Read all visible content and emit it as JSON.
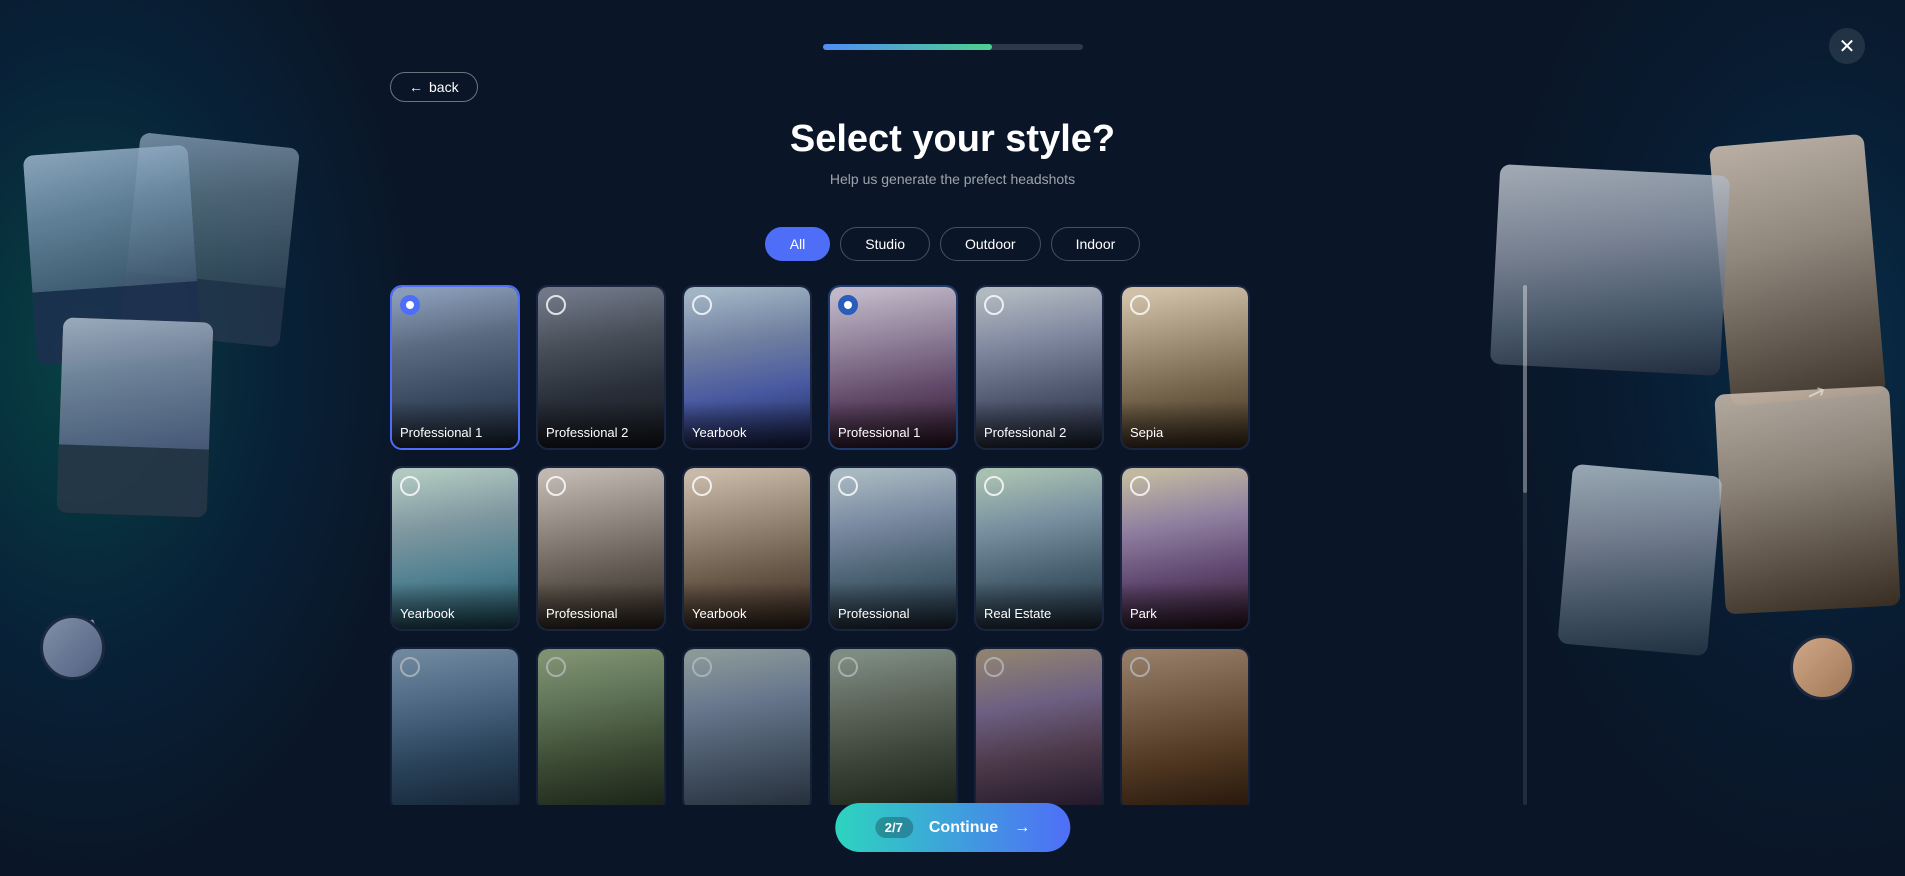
{
  "progress": {
    "fill_percent": "65%",
    "current_step": "2",
    "total_steps": "7",
    "step_label": "2/7"
  },
  "close_button": "✕",
  "back_button": {
    "label": "back",
    "arrow": "←"
  },
  "title": "Select your style?",
  "subtitle": "Help us generate the prefect headshots",
  "filters": [
    {
      "id": "all",
      "label": "All",
      "active": true
    },
    {
      "id": "studio",
      "label": "Studio",
      "active": false
    },
    {
      "id": "outdoor",
      "label": "Outdoor",
      "active": false
    },
    {
      "id": "indoor",
      "label": "Indoor",
      "active": false
    }
  ],
  "cards": [
    {
      "id": "pro1-male",
      "label": "Professional 1",
      "selected": "blue",
      "row": 1
    },
    {
      "id": "pro2-male",
      "label": "Professional 2",
      "selected": "none",
      "row": 1
    },
    {
      "id": "yearbook-male",
      "label": "Yearbook",
      "selected": "none",
      "row": 1
    },
    {
      "id": "pro1-female",
      "label": "Professional 1",
      "selected": "dark",
      "row": 1
    },
    {
      "id": "pro2-female",
      "label": "Professional 2",
      "selected": "none",
      "row": 1
    },
    {
      "id": "sepia",
      "label": "Sepia",
      "selected": "none",
      "row": 1
    },
    {
      "id": "yearbook-female",
      "label": "Yearbook",
      "selected": "none",
      "row": 2
    },
    {
      "id": "pro-female2",
      "label": "Professional",
      "selected": "none",
      "row": 2
    },
    {
      "id": "yearbook-female2",
      "label": "Yearbook",
      "selected": "none",
      "row": 2
    },
    {
      "id": "pro-male2",
      "label": "Professional",
      "selected": "none",
      "row": 2
    },
    {
      "id": "real-estate",
      "label": "Real Estate",
      "selected": "none",
      "row": 2
    },
    {
      "id": "park",
      "label": "Park",
      "selected": "none",
      "row": 2
    },
    {
      "id": "card13",
      "label": "",
      "selected": "none",
      "row": 3
    },
    {
      "id": "card14",
      "label": "",
      "selected": "none",
      "row": 3
    },
    {
      "id": "card15",
      "label": "",
      "selected": "none",
      "row": 3
    },
    {
      "id": "card16",
      "label": "",
      "selected": "none",
      "row": 3
    },
    {
      "id": "card17",
      "label": "",
      "selected": "none",
      "row": 3
    },
    {
      "id": "card18",
      "label": "",
      "selected": "none",
      "row": 3
    }
  ],
  "continue_button": {
    "label": "Continue",
    "arrow": "→",
    "step": "2/7"
  }
}
